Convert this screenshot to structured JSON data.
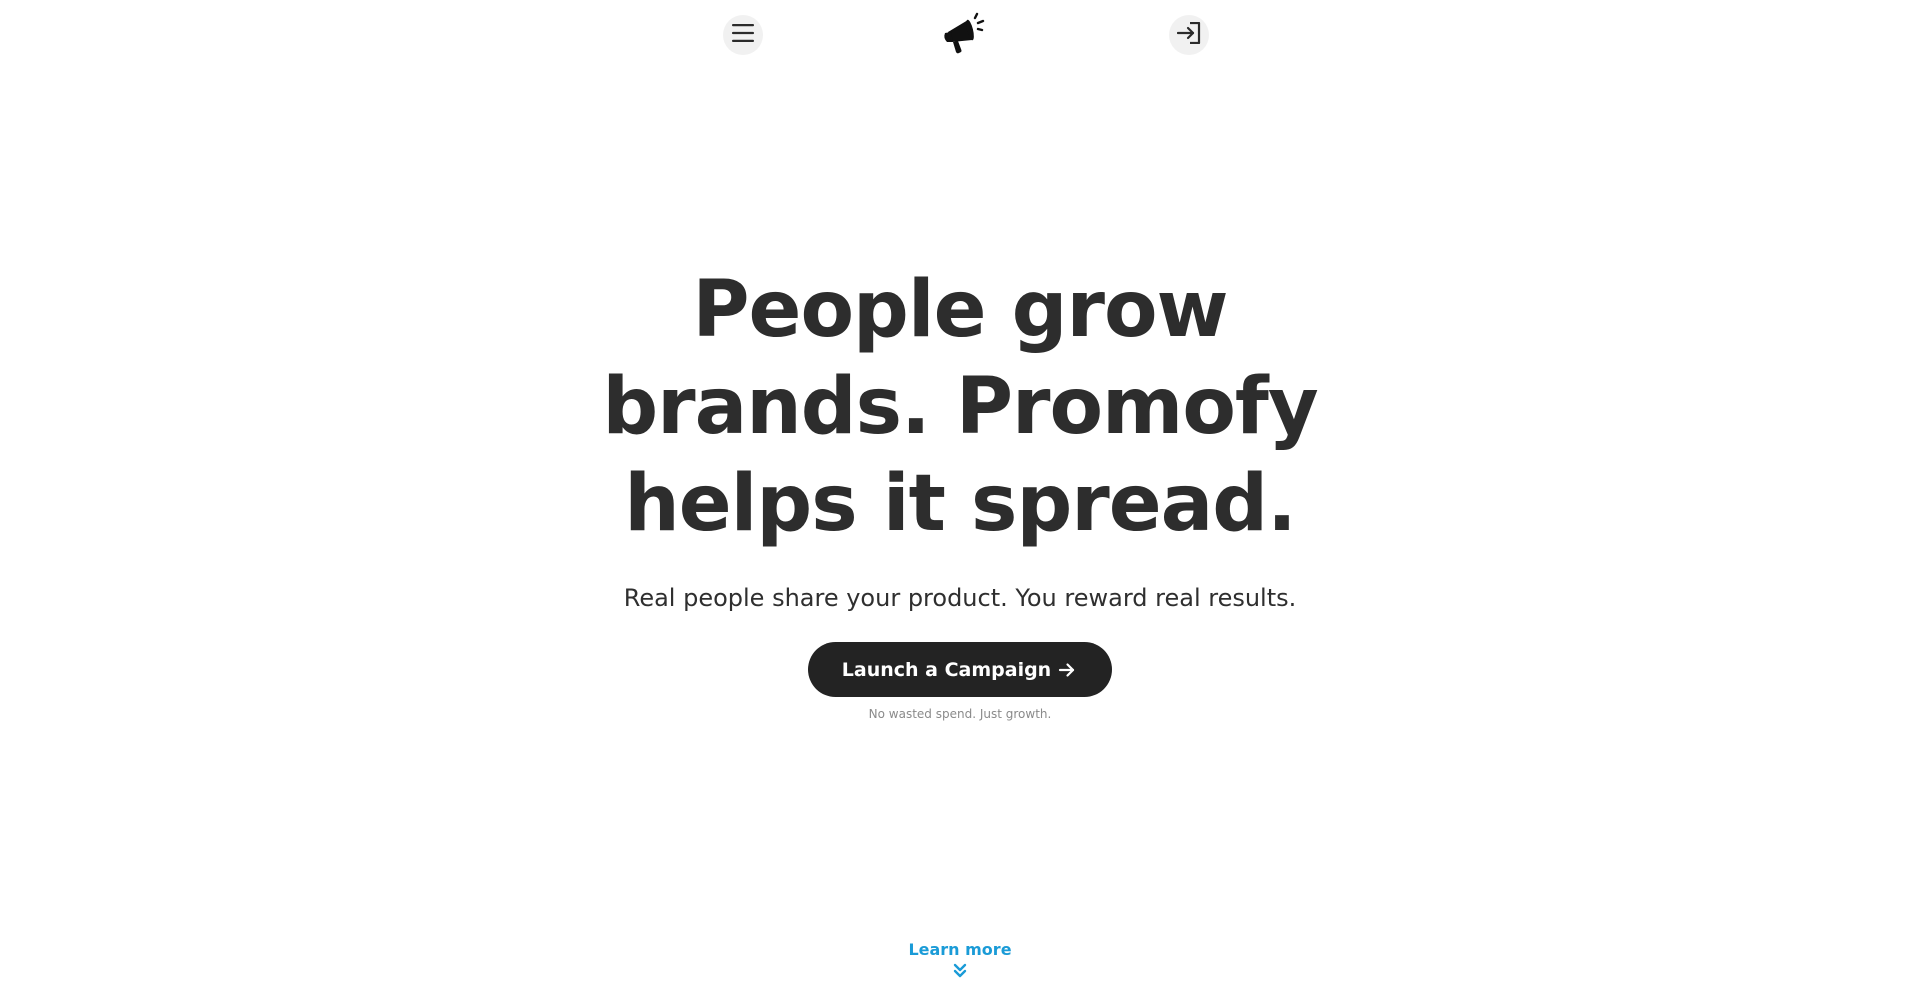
{
  "header": {
    "menu_icon": "hamburger-menu-icon",
    "logo_icon": "megaphone-icon",
    "login_icon": "sign-in-icon"
  },
  "hero": {
    "headline_lines": [
      "People grow",
      "brands. Promofy",
      "helps it spread."
    ],
    "subheadline": "Real people share your product. You reward real results.",
    "cta_label": "Launch a Campaign",
    "cta_icon": "arrow-right-icon",
    "tagline": "No wasted spend. Just growth."
  },
  "footer_prompt": {
    "learn_more_label": "Learn more",
    "icon": "chevrons-down-icon"
  },
  "colors": {
    "text": "#2d2d2d",
    "cta_background": "#232323",
    "cta_text": "#ffffff",
    "link_accent": "#1a9bd7",
    "nav_button_bg": "#f1f1f1",
    "tagline": "#8a8a8a"
  }
}
